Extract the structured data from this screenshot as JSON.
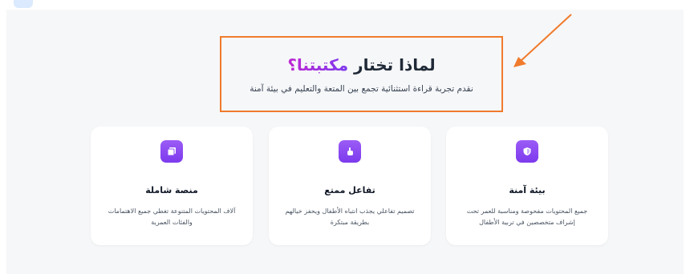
{
  "section": {
    "title_prefix": "لماذا تختار ",
    "title_accent": "مكتبتنا؟",
    "subtitle": "نقدم تجربة قراءة استثنائية تجمع بين المتعة والتعليم في بيئة آمنة"
  },
  "features": [
    {
      "icon": "shield-icon",
      "title": "بيئة آمنة",
      "description": "جميع المحتويات مفحوصة ومناسبة للعمر تحت إشراف متخصصين في تربية الأطفال"
    },
    {
      "icon": "hand-pointer-icon",
      "title": "تفاعل ممتع",
      "description": "تصميم تفاعلي يجذب انتباه الأطفال ويحفز خيالهم بطريقة مبتكرة"
    },
    {
      "icon": "layers-icon",
      "title": "منصة شاملة",
      "description": "آلاف المحتويات المتنوعة تغطي جميع الاهتمامات والفئات العمرية"
    }
  ],
  "colors": {
    "accent_start": "#c026d3",
    "accent_end": "#7c3aed",
    "annotation": "#f07b2c"
  }
}
